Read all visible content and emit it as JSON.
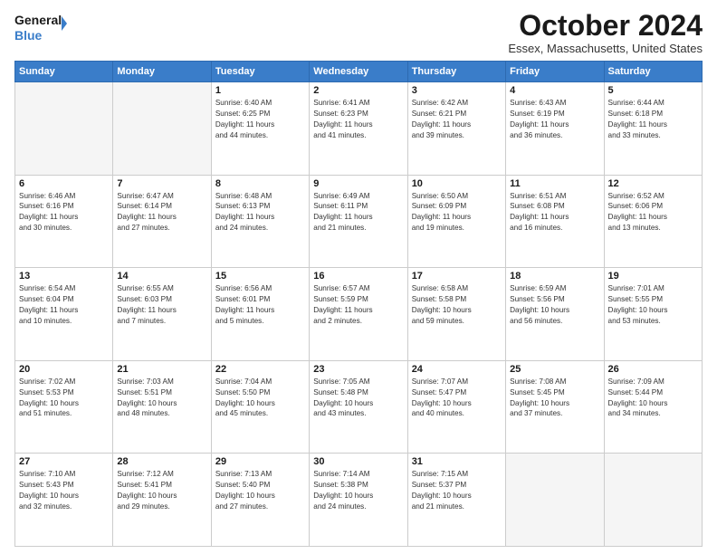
{
  "logo": {
    "line1": "General",
    "line2": "Blue",
    "icon": "▶"
  },
  "title": "October 2024",
  "location": "Essex, Massachusetts, United States",
  "weekdays": [
    "Sunday",
    "Monday",
    "Tuesday",
    "Wednesday",
    "Thursday",
    "Friday",
    "Saturday"
  ],
  "weeks": [
    [
      {
        "day": "",
        "info": ""
      },
      {
        "day": "",
        "info": ""
      },
      {
        "day": "1",
        "info": "Sunrise: 6:40 AM\nSunset: 6:25 PM\nDaylight: 11 hours\nand 44 minutes."
      },
      {
        "day": "2",
        "info": "Sunrise: 6:41 AM\nSunset: 6:23 PM\nDaylight: 11 hours\nand 41 minutes."
      },
      {
        "day": "3",
        "info": "Sunrise: 6:42 AM\nSunset: 6:21 PM\nDaylight: 11 hours\nand 39 minutes."
      },
      {
        "day": "4",
        "info": "Sunrise: 6:43 AM\nSunset: 6:19 PM\nDaylight: 11 hours\nand 36 minutes."
      },
      {
        "day": "5",
        "info": "Sunrise: 6:44 AM\nSunset: 6:18 PM\nDaylight: 11 hours\nand 33 minutes."
      }
    ],
    [
      {
        "day": "6",
        "info": "Sunrise: 6:46 AM\nSunset: 6:16 PM\nDaylight: 11 hours\nand 30 minutes."
      },
      {
        "day": "7",
        "info": "Sunrise: 6:47 AM\nSunset: 6:14 PM\nDaylight: 11 hours\nand 27 minutes."
      },
      {
        "day": "8",
        "info": "Sunrise: 6:48 AM\nSunset: 6:13 PM\nDaylight: 11 hours\nand 24 minutes."
      },
      {
        "day": "9",
        "info": "Sunrise: 6:49 AM\nSunset: 6:11 PM\nDaylight: 11 hours\nand 21 minutes."
      },
      {
        "day": "10",
        "info": "Sunrise: 6:50 AM\nSunset: 6:09 PM\nDaylight: 11 hours\nand 19 minutes."
      },
      {
        "day": "11",
        "info": "Sunrise: 6:51 AM\nSunset: 6:08 PM\nDaylight: 11 hours\nand 16 minutes."
      },
      {
        "day": "12",
        "info": "Sunrise: 6:52 AM\nSunset: 6:06 PM\nDaylight: 11 hours\nand 13 minutes."
      }
    ],
    [
      {
        "day": "13",
        "info": "Sunrise: 6:54 AM\nSunset: 6:04 PM\nDaylight: 11 hours\nand 10 minutes."
      },
      {
        "day": "14",
        "info": "Sunrise: 6:55 AM\nSunset: 6:03 PM\nDaylight: 11 hours\nand 7 minutes."
      },
      {
        "day": "15",
        "info": "Sunrise: 6:56 AM\nSunset: 6:01 PM\nDaylight: 11 hours\nand 5 minutes."
      },
      {
        "day": "16",
        "info": "Sunrise: 6:57 AM\nSunset: 5:59 PM\nDaylight: 11 hours\nand 2 minutes."
      },
      {
        "day": "17",
        "info": "Sunrise: 6:58 AM\nSunset: 5:58 PM\nDaylight: 10 hours\nand 59 minutes."
      },
      {
        "day": "18",
        "info": "Sunrise: 6:59 AM\nSunset: 5:56 PM\nDaylight: 10 hours\nand 56 minutes."
      },
      {
        "day": "19",
        "info": "Sunrise: 7:01 AM\nSunset: 5:55 PM\nDaylight: 10 hours\nand 53 minutes."
      }
    ],
    [
      {
        "day": "20",
        "info": "Sunrise: 7:02 AM\nSunset: 5:53 PM\nDaylight: 10 hours\nand 51 minutes."
      },
      {
        "day": "21",
        "info": "Sunrise: 7:03 AM\nSunset: 5:51 PM\nDaylight: 10 hours\nand 48 minutes."
      },
      {
        "day": "22",
        "info": "Sunrise: 7:04 AM\nSunset: 5:50 PM\nDaylight: 10 hours\nand 45 minutes."
      },
      {
        "day": "23",
        "info": "Sunrise: 7:05 AM\nSunset: 5:48 PM\nDaylight: 10 hours\nand 43 minutes."
      },
      {
        "day": "24",
        "info": "Sunrise: 7:07 AM\nSunset: 5:47 PM\nDaylight: 10 hours\nand 40 minutes."
      },
      {
        "day": "25",
        "info": "Sunrise: 7:08 AM\nSunset: 5:45 PM\nDaylight: 10 hours\nand 37 minutes."
      },
      {
        "day": "26",
        "info": "Sunrise: 7:09 AM\nSunset: 5:44 PM\nDaylight: 10 hours\nand 34 minutes."
      }
    ],
    [
      {
        "day": "27",
        "info": "Sunrise: 7:10 AM\nSunset: 5:43 PM\nDaylight: 10 hours\nand 32 minutes."
      },
      {
        "day": "28",
        "info": "Sunrise: 7:12 AM\nSunset: 5:41 PM\nDaylight: 10 hours\nand 29 minutes."
      },
      {
        "day": "29",
        "info": "Sunrise: 7:13 AM\nSunset: 5:40 PM\nDaylight: 10 hours\nand 27 minutes."
      },
      {
        "day": "30",
        "info": "Sunrise: 7:14 AM\nSunset: 5:38 PM\nDaylight: 10 hours\nand 24 minutes."
      },
      {
        "day": "31",
        "info": "Sunrise: 7:15 AM\nSunset: 5:37 PM\nDaylight: 10 hours\nand 21 minutes."
      },
      {
        "day": "",
        "info": ""
      },
      {
        "day": "",
        "info": ""
      }
    ]
  ]
}
